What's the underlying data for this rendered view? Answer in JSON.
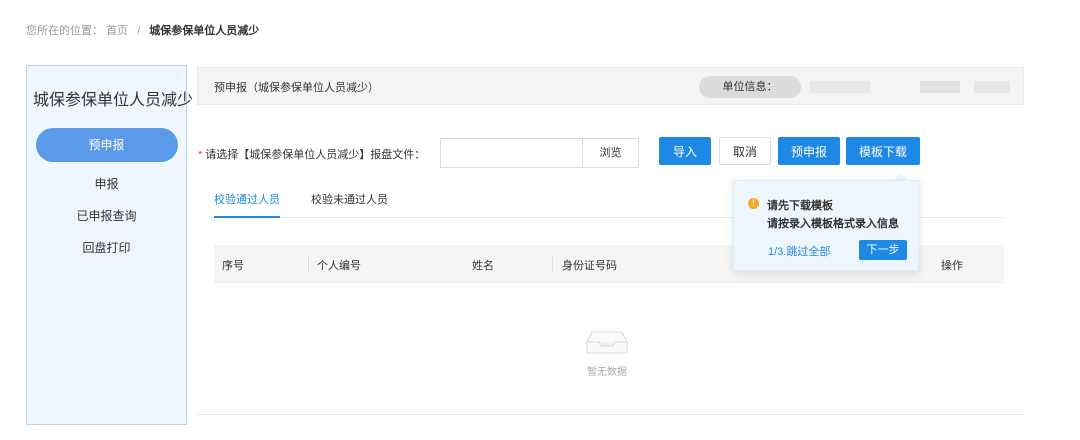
{
  "breadcrumb": {
    "prefix": "您所在的位置：",
    "home": "首页",
    "separator": "/",
    "current": "城保参保单位人员减少"
  },
  "sidebar": {
    "title": "城保参保单位人员减少",
    "items": [
      {
        "label": "预申报",
        "active": true
      },
      {
        "label": "申报",
        "active": false
      },
      {
        "label": "已申报查询",
        "active": false
      },
      {
        "label": "回盘打印",
        "active": false
      }
    ]
  },
  "header": {
    "title": "预申报（城保参保单位人员减少）",
    "unit_label": "单位信息："
  },
  "file_select": {
    "required_mark": "*",
    "label": "请选择【城保参保单位人员减少】报盘文件：",
    "value": "",
    "browse_label": "浏览"
  },
  "toolbar": {
    "import_label": "导入",
    "cancel_label": "取消",
    "prereport_label": "预申报",
    "template_label": "模板下载"
  },
  "tabs": [
    {
      "label": "校验通过人员",
      "active": true
    },
    {
      "label": "校验未通过人员",
      "active": false
    }
  ],
  "table": {
    "columns": [
      "序号",
      "个人编号",
      "姓名",
      "身份证号码",
      "操作"
    ],
    "rows": [],
    "empty_text": "暂无数据"
  },
  "guide_popover": {
    "warn_glyph": "!",
    "line1": "请先下载模板",
    "line2": "请按录入模板格式录入信息",
    "progress": "1/3.跳过全部",
    "next_label": "下一步"
  },
  "colors": {
    "primary": "#1e88e5",
    "sidebar_active": "#5a9ae8",
    "sidebar_bg": "#f0f6fd",
    "warning": "#f5a623",
    "required": "#e53e3e"
  },
  "icons": {
    "empty_state": "empty-inbox-icon",
    "warning": "warning-circle-icon"
  }
}
